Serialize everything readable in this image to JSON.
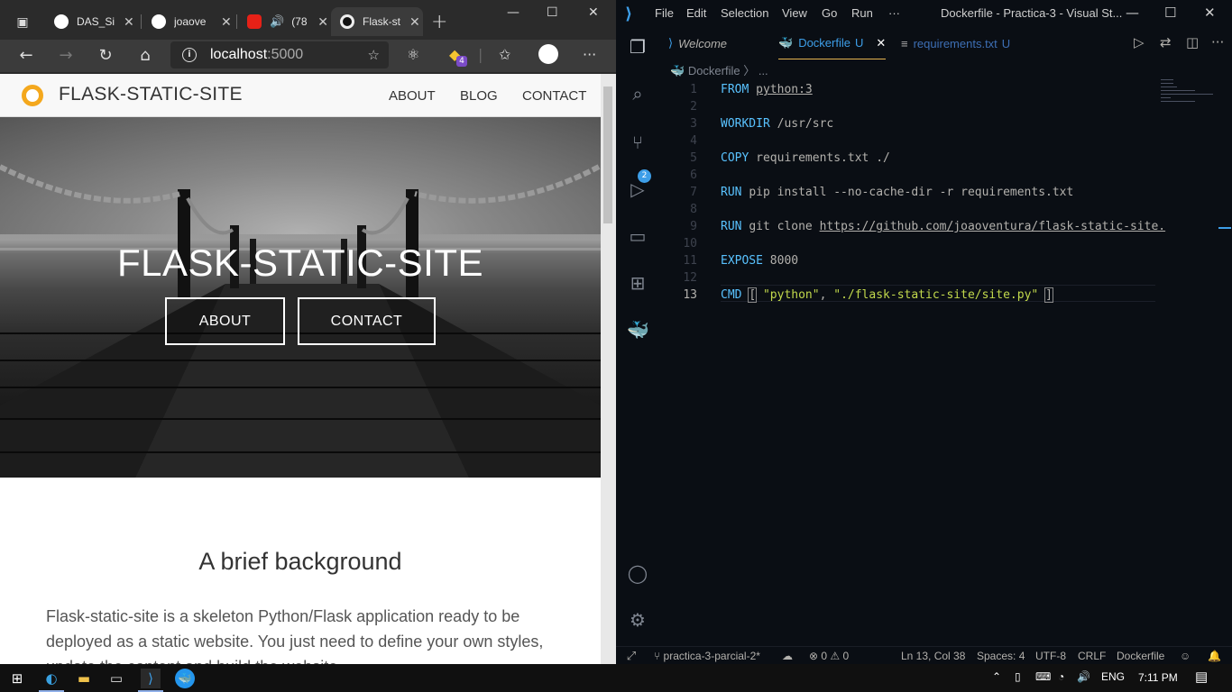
{
  "browser": {
    "tabs": [
      {
        "title": "DAS_Si",
        "close": "✕"
      },
      {
        "title": "joaove",
        "close": "✕"
      },
      {
        "title": "(78",
        "close": "✕"
      },
      {
        "title": "Flask-st",
        "close": "✕"
      }
    ],
    "new_tab": "+",
    "url": {
      "host": "localhost",
      "port": ":5000"
    },
    "extension_badge": "4"
  },
  "site": {
    "brand": "FLASK-STATIC-SITE",
    "nav": [
      "ABOUT",
      "BLOG",
      "CONTACT"
    ],
    "hero_title": "FLASK-STATIC-SITE",
    "hero_buttons": [
      "ABOUT",
      "CONTACT"
    ],
    "section_title": "A brief background",
    "section_text": "Flask-static-site is a skeleton Python/Flask application ready to be deployed as a static website. You just need to define your own styles, update the content and build the website."
  },
  "vscode": {
    "menu": [
      "File",
      "Edit",
      "Selection",
      "View",
      "Go",
      "Run",
      "···"
    ],
    "window_title": "Dockerfile - Practica-3 - Visual St...",
    "tabs": [
      {
        "label": "Welcome",
        "suffix": ""
      },
      {
        "label": "Dockerfile",
        "suffix": "U"
      },
      {
        "label": "requirements.txt",
        "suffix": "U"
      }
    ],
    "breadcrumb": "Dockerfile  〉 ...",
    "scm_badge": "2",
    "lines": [
      {
        "n": "1",
        "kw": "FROM",
        "rest": "python:3"
      },
      {
        "n": "2",
        "kw": "",
        "rest": ""
      },
      {
        "n": "3",
        "kw": "WORKDIR",
        "rest": "/usr/src"
      },
      {
        "n": "4",
        "kw": "",
        "rest": ""
      },
      {
        "n": "5",
        "kw": "COPY",
        "rest": "requirements.txt ./"
      },
      {
        "n": "6",
        "kw": "",
        "rest": ""
      },
      {
        "n": "7",
        "kw": "RUN",
        "rest": "pip install --no-cache-dir -r requirements.txt"
      },
      {
        "n": "8",
        "kw": "",
        "rest": ""
      },
      {
        "n": "9",
        "kw": "RUN",
        "rest": "git clone ",
        "link": "https://github.com/joaoventura/flask-static-site."
      },
      {
        "n": "10",
        "kw": "",
        "rest": ""
      },
      {
        "n": "11",
        "kw": "EXPOSE",
        "rest": "8000"
      },
      {
        "n": "12",
        "kw": "",
        "rest": ""
      },
      {
        "n": "13",
        "kw": "CMD",
        "rest": ""
      }
    ],
    "cmd_parts": {
      "open": "[",
      "s1": "\"python\"",
      "comma": ", ",
      "s2": "\"./flask-static-site/site.py\"",
      "close": "]"
    },
    "status": {
      "branch": "practica-3-parcial-2*",
      "errors": "0",
      "warnings": "0",
      "position": "Ln 13, Col 38",
      "spaces": "Spaces: 4",
      "encoding": "UTF-8",
      "eol": "CRLF",
      "language": "Dockerfile"
    }
  },
  "taskbar": {
    "lang": "ENG",
    "time": "7:11 PM"
  },
  "colors": {
    "accent_yellow": "#f4a81d",
    "vscode_bg": "#0a0e14",
    "keyword": "#59c2ff",
    "string": "#c2d94c"
  }
}
